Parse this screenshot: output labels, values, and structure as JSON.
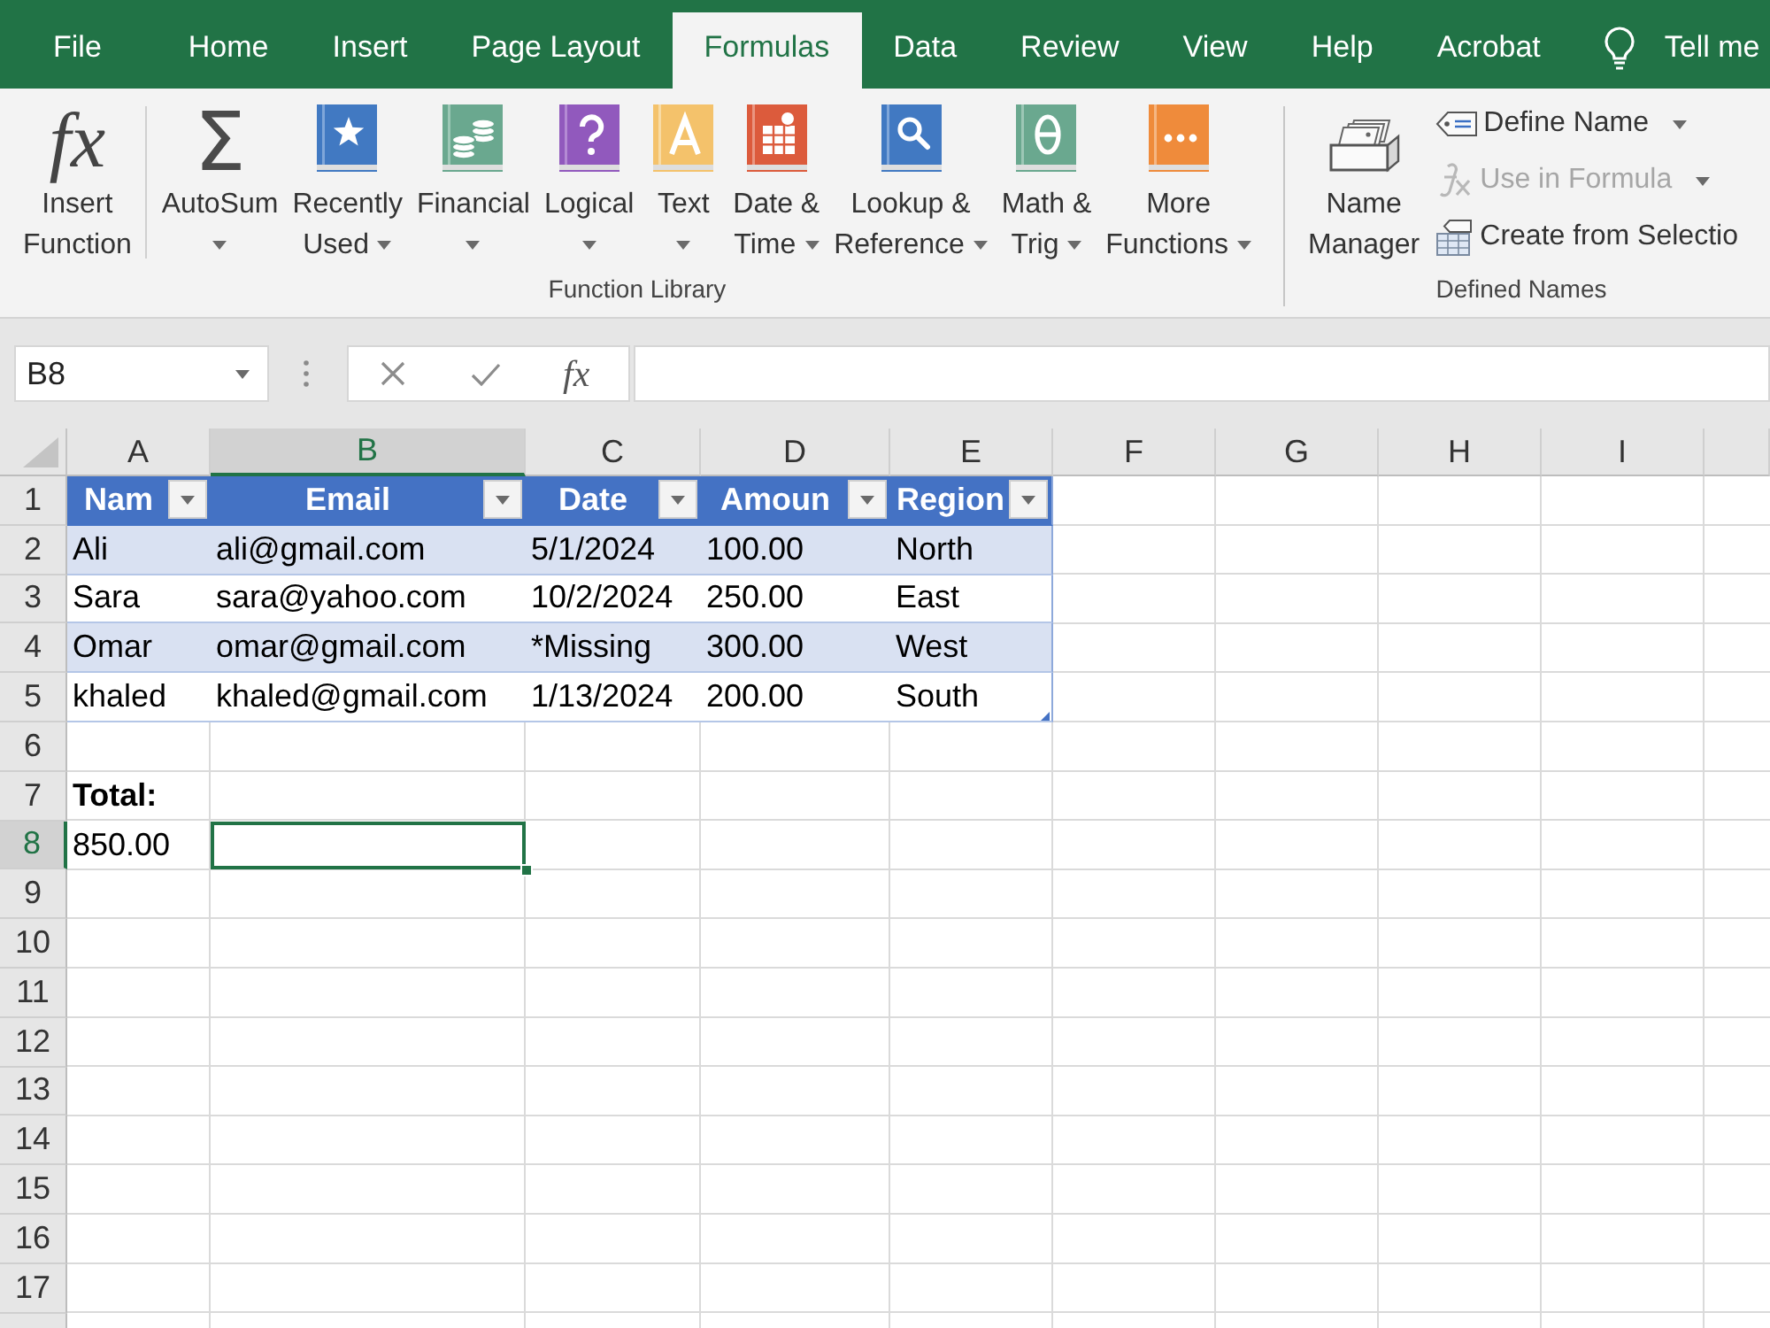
{
  "tabs": [
    {
      "label": "File",
      "selected": false
    },
    {
      "label": "Home",
      "selected": false
    },
    {
      "label": "Insert",
      "selected": false
    },
    {
      "label": "Page Layout",
      "selected": false
    },
    {
      "label": "Formulas",
      "selected": true
    },
    {
      "label": "Data",
      "selected": false
    },
    {
      "label": "Review",
      "selected": false
    },
    {
      "label": "View",
      "selected": false
    },
    {
      "label": "Help",
      "selected": false
    },
    {
      "label": "Acrobat",
      "selected": false
    }
  ],
  "tell_me": {
    "label": "Tell me"
  },
  "ribbon": {
    "groups": [
      {
        "label": "Function Library",
        "sections": [
          [
            {
              "kind": "large",
              "glyph": "fx",
              "lines": [
                "Insert",
                "Function"
              ],
              "dropdown": false,
              "disabled": false
            }
          ],
          [
            {
              "kind": "large",
              "glyph": "Σ",
              "lines": [
                "AutoSum"
              ],
              "dropdown": true,
              "disabled": false
            },
            {
              "kind": "large",
              "lines": [
                "Recently",
                "Used"
              ],
              "dropdown": true,
              "disabled": false
            },
            {
              "kind": "large",
              "lines": [
                "Financial"
              ],
              "dropdown": true,
              "disabled": false
            },
            {
              "kind": "large",
              "lines": [
                "Logical"
              ],
              "dropdown": true,
              "disabled": false
            },
            {
              "kind": "large",
              "lines": [
                "Text"
              ],
              "dropdown": true,
              "disabled": false
            },
            {
              "kind": "large",
              "lines": [
                "Date &",
                "Time"
              ],
              "dropdown": true,
              "disabled": false
            },
            {
              "kind": "large",
              "lines": [
                "Lookup &",
                "Reference"
              ],
              "dropdown": true,
              "disabled": false
            },
            {
              "kind": "large",
              "lines": [
                "Math &",
                "Trig"
              ],
              "dropdown": true,
              "disabled": false
            },
            {
              "kind": "large",
              "lines": [
                "More",
                "Functions"
              ],
              "dropdown": true,
              "disabled": false
            }
          ]
        ]
      },
      {
        "label": "Defined Names",
        "sections": [
          [
            {
              "kind": "large",
              "lines": [
                "Name",
                "Manager"
              ],
              "dropdown": false,
              "disabled": false
            },
            {
              "kind": "small",
              "lines": [
                "Define Name"
              ],
              "dropdown": true,
              "disabled": false
            },
            {
              "kind": "small",
              "lines": [
                "Use in Formula"
              ],
              "dropdown": true,
              "disabled": true
            },
            {
              "kind": "small",
              "lines": [
                "Create from Selectio"
              ],
              "dropdown": false,
              "disabled": false
            }
          ]
        ]
      }
    ]
  },
  "formula_bar": {
    "name_box": "B8",
    "function_glyph": "fx"
  },
  "sheet": {
    "columns": [
      {
        "label": "A",
        "selected": false
      },
      {
        "label": "B",
        "selected": true
      },
      {
        "label": "C",
        "selected": false
      },
      {
        "label": "D",
        "selected": false
      },
      {
        "label": "E",
        "selected": false
      },
      {
        "label": "F",
        "selected": false
      },
      {
        "label": "G",
        "selected": false
      },
      {
        "label": "H",
        "selected": false
      },
      {
        "label": "I",
        "selected": false
      }
    ],
    "rows": [
      {
        "label": "1",
        "selected": false,
        "kind": "table-header",
        "cells": [
          {
            "text": "Nam"
          },
          {
            "text": "Email"
          },
          {
            "text": "Date"
          },
          {
            "text": "Amoun"
          },
          {
            "text": "Region"
          }
        ]
      },
      {
        "label": "2",
        "selected": false,
        "kind": "table-row",
        "cells": [
          {
            "text": "Ali"
          },
          {
            "text": "ali@gmail.com"
          },
          {
            "text": "5/1/2024"
          },
          {
            "text": "100.00"
          },
          {
            "text": "North"
          }
        ]
      },
      {
        "label": "3",
        "selected": false,
        "kind": "table-row",
        "cells": [
          {
            "text": "Sara"
          },
          {
            "text": "sara@yahoo.com"
          },
          {
            "text": "10/2/2024"
          },
          {
            "text": "250.00"
          },
          {
            "text": "East"
          }
        ]
      },
      {
        "label": "4",
        "selected": false,
        "kind": "table-row",
        "cells": [
          {
            "text": "Omar"
          },
          {
            "text": "omar@gmail.com"
          },
          {
            "text": "*Missing"
          },
          {
            "text": "300.00"
          },
          {
            "text": "West"
          }
        ]
      },
      {
        "label": "5",
        "selected": false,
        "kind": "table-row",
        "cells": [
          {
            "text": "khaled"
          },
          {
            "text": "khaled@gmail.com"
          },
          {
            "text": "1/13/2024"
          },
          {
            "text": "200.00"
          },
          {
            "text": "South"
          }
        ]
      },
      {
        "label": "6",
        "selected": false,
        "kind": "plain"
      },
      {
        "label": "7",
        "selected": false,
        "kind": "plain",
        "cells": [
          {
            "text": "Total:",
            "bold": true
          }
        ]
      },
      {
        "label": "8",
        "selected": true,
        "kind": "plain",
        "cells": [
          {
            "text": "850.00",
            "bold": false
          }
        ]
      },
      {
        "label": "9",
        "selected": false,
        "kind": "plain"
      },
      {
        "label": "10",
        "selected": false,
        "kind": "plain"
      },
      {
        "label": "11",
        "selected": false,
        "kind": "plain"
      },
      {
        "label": "12",
        "selected": false,
        "kind": "plain"
      },
      {
        "label": "13",
        "selected": false,
        "kind": "plain"
      },
      {
        "label": "14",
        "selected": false,
        "kind": "plain"
      },
      {
        "label": "15",
        "selected": false,
        "kind": "plain"
      },
      {
        "label": "16",
        "selected": false,
        "kind": "plain"
      },
      {
        "label": "17",
        "selected": false,
        "kind": "plain"
      }
    ]
  }
}
